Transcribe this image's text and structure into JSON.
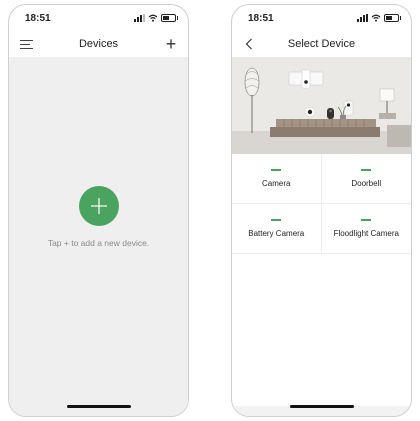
{
  "left_screen": {
    "status_time": "18:51",
    "title": "Devices",
    "add_icon_label": "+",
    "empty_message": "Tap + to add a new device."
  },
  "right_screen": {
    "status_time": "18:51",
    "title": "Select Device",
    "devices": [
      {
        "label": "Camera"
      },
      {
        "label": "Doorbell"
      },
      {
        "label": "Battery Camera"
      },
      {
        "label": "Floodlight Camera"
      }
    ]
  },
  "colors": {
    "accent_green": "#4ba360",
    "screen_bg": "#efefef"
  },
  "icons": [
    "menu-icon",
    "plus-icon",
    "back-chevron-icon",
    "signal-icon",
    "wifi-icon",
    "battery-icon"
  ]
}
